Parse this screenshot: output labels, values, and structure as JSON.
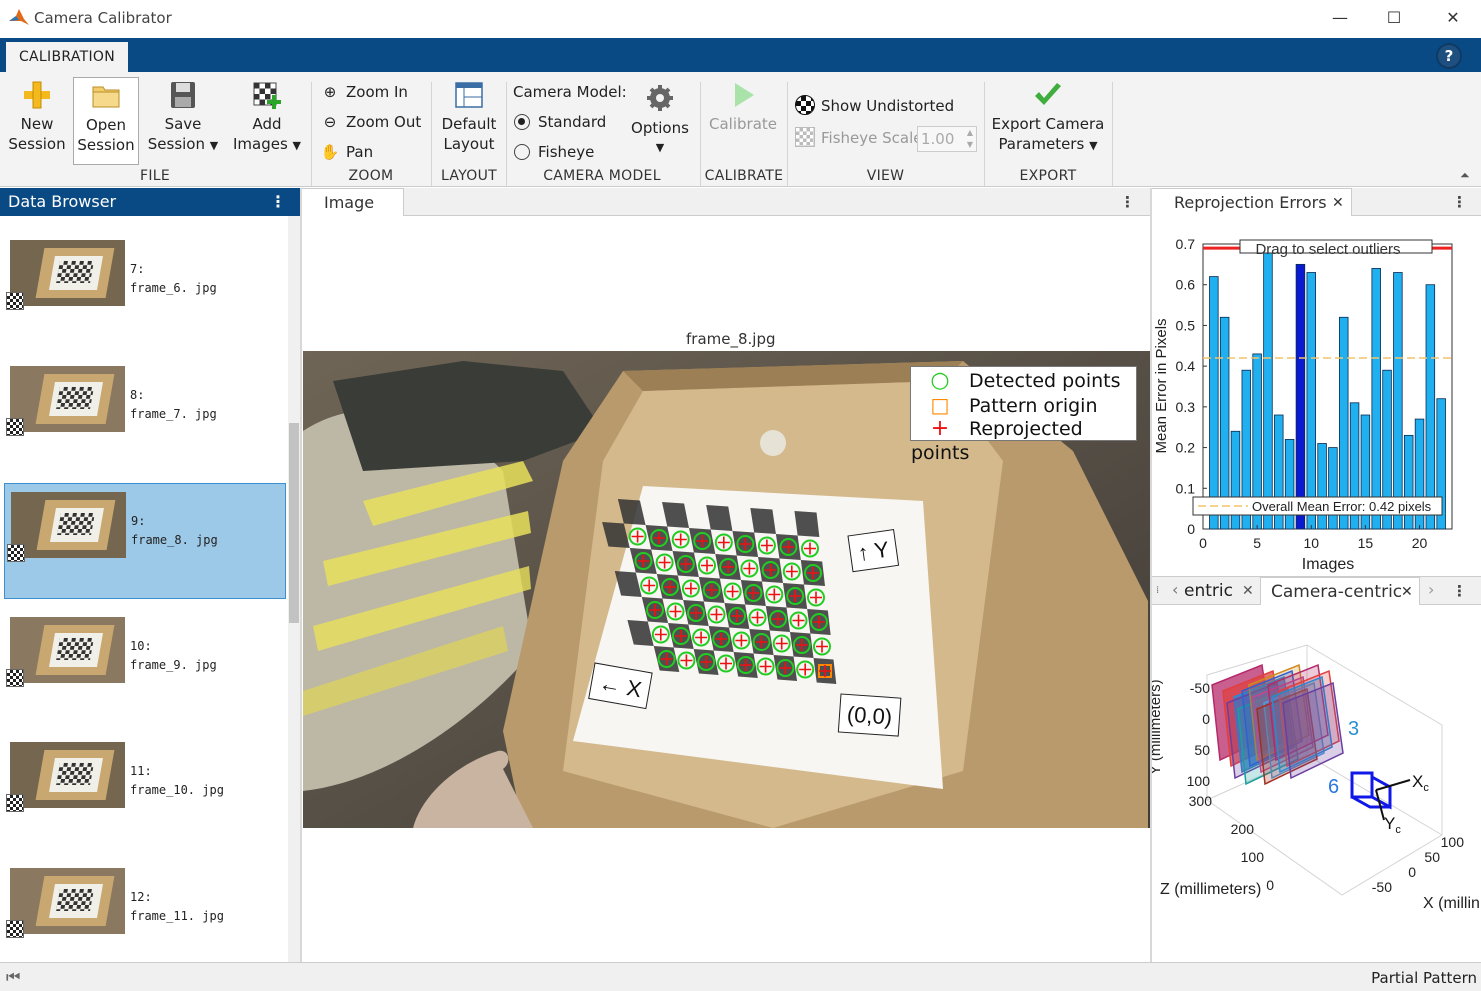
{
  "window": {
    "title": "Camera Calibrator",
    "minimize": "—",
    "maximize": "☐",
    "close": "✕"
  },
  "tabs": {
    "calibration": "CALIBRATION",
    "help": "?"
  },
  "ribbon": {
    "file": {
      "new": [
        "New",
        "Session"
      ],
      "open": [
        "Open",
        "Session"
      ],
      "save": [
        "Save",
        "Session"
      ],
      "add": [
        "Add",
        "Images"
      ],
      "label": "FILE"
    },
    "zoom": {
      "zoom_in": "Zoom In",
      "zoom_out": "Zoom Out",
      "pan": "Pan",
      "label": "ZOOM"
    },
    "layout": {
      "default": [
        "Default",
        "Layout"
      ],
      "label": "LAYOUT"
    },
    "camera_model": {
      "title": "Camera Model:",
      "standard": "Standard",
      "fisheye": "Fisheye",
      "options": "Options",
      "label": "CAMERA MODEL",
      "selected": "Standard"
    },
    "calibrate": {
      "button": "Calibrate",
      "label": "CALIBRATE"
    },
    "view": {
      "show_undistorted": "Show Undistorted",
      "fisheye_scale": "Fisheye Scale",
      "fisheye_scale_value": "1.00",
      "label": "VIEW"
    },
    "export": {
      "button": [
        "Export Camera",
        "Parameters"
      ],
      "label": "EXPORT"
    }
  },
  "data_browser": {
    "title": "Data Browser",
    "items": [
      {
        "index": "7:",
        "file": "frame_6. jpg",
        "selected": false
      },
      {
        "index": "8:",
        "file": "frame_7. jpg",
        "selected": false
      },
      {
        "index": "9:",
        "file": "frame_8. jpg",
        "selected": true
      },
      {
        "index": "10:",
        "file": "frame_9. jpg",
        "selected": false
      },
      {
        "index": "11:",
        "file": "frame_10. jpg",
        "selected": false
      },
      {
        "index": "12:",
        "file": "frame_11. jpg",
        "selected": false
      }
    ]
  },
  "image_panel": {
    "tab": "Image",
    "frame_title": "frame_8.jpg",
    "legend": {
      "detected": "Detected points",
      "origin": "Pattern origin",
      "reprojected": "Reprojected points"
    },
    "labels": {
      "y_axis": "↑ Y",
      "x_axis": "← X",
      "origin": "(0,0)"
    },
    "colors": {
      "detected": "#22cc22",
      "origin": "#ff8800",
      "reprojected": "#ee1111"
    }
  },
  "reprojection_panel": {
    "tab": "Reprojection Errors",
    "chart_data": {
      "type": "bar",
      "xlabel": "Images",
      "ylabel": "Mean Error in Pixels",
      "ylim": [
        0,
        0.7
      ],
      "xlim": [
        0,
        23
      ],
      "xticks": [
        "0",
        "5",
        "10",
        "15",
        "20"
      ],
      "yticks": [
        "0",
        "0.1",
        "0.2",
        "0.3",
        "0.4",
        "0.5",
        "0.6",
        "0.7"
      ],
      "categories": [
        1,
        2,
        3,
        4,
        5,
        6,
        7,
        8,
        9,
        10,
        11,
        12,
        13,
        14,
        15,
        16,
        17,
        18,
        19,
        20,
        21,
        22
      ],
      "values": [
        0.62,
        0.52,
        0.24,
        0.39,
        0.43,
        0.68,
        0.28,
        0.22,
        0.65,
        0.63,
        0.21,
        0.2,
        0.52,
        0.31,
        0.28,
        0.64,
        0.39,
        0.63,
        0.23,
        0.27,
        0.6,
        0.32
      ],
      "highlighted": 9,
      "threshold": 0.69,
      "overall_mean": 0.42,
      "threshold_label": "Drag to select outliers",
      "mean_label": "Overall Mean Error: 0.42 pixels",
      "colors": {
        "bar": "#20b0f0",
        "highlight": "#0a1ad0",
        "threshold": "#ee2222",
        "mean": "#f2c46a"
      }
    }
  },
  "camera_panel": {
    "tabs": [
      "entric",
      "Camera-centric"
    ],
    "axis_labels": {
      "y": "Y (millimeters)",
      "z": "Z (millimeters)",
      "x": "X (millin"
    },
    "y_ticks": [
      "-50",
      "0",
      "50",
      "100"
    ],
    "z_ticks": [
      "300",
      "200",
      "100",
      "0"
    ],
    "x_ticks": [
      "-50",
      "0",
      "50",
      "100"
    ],
    "camera_labels": {
      "xc": "X",
      "yc": "Y",
      "sub": "c"
    },
    "plane_labels": [
      "3",
      "6"
    ]
  },
  "status": {
    "text": "Partial Pattern"
  }
}
